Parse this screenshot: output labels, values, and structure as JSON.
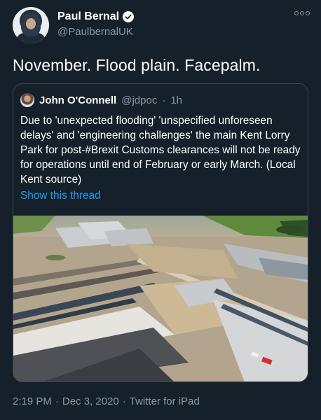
{
  "author": {
    "name": "Paul Bernal",
    "handle": "@PaulbernalUK",
    "verified_icon": "verified-badge-icon"
  },
  "tweet": {
    "text": "November. Flood plain. Facepalm."
  },
  "quoted": {
    "name": "John O'Connell",
    "handle": "@jdpoc",
    "separator": "·",
    "time": "1h",
    "text": "Due to 'unexpected flooding' 'unspecified unforeseen delays' and 'engineering challenges' the main Kent Lorry Park for post-#Brexit Customs clearances will not be ready for operations until end of February or early March. (Local Kent source)",
    "show_thread": "Show this thread"
  },
  "meta": {
    "time": "2:19 PM",
    "sep1": "·",
    "date": "Dec 3, 2020",
    "sep2": "·",
    "source": "Twitter for iPad"
  },
  "colors": {
    "background": "#15202b",
    "secondary_text": "#8899a6",
    "link": "#1da1f2",
    "border": "#38444d"
  }
}
